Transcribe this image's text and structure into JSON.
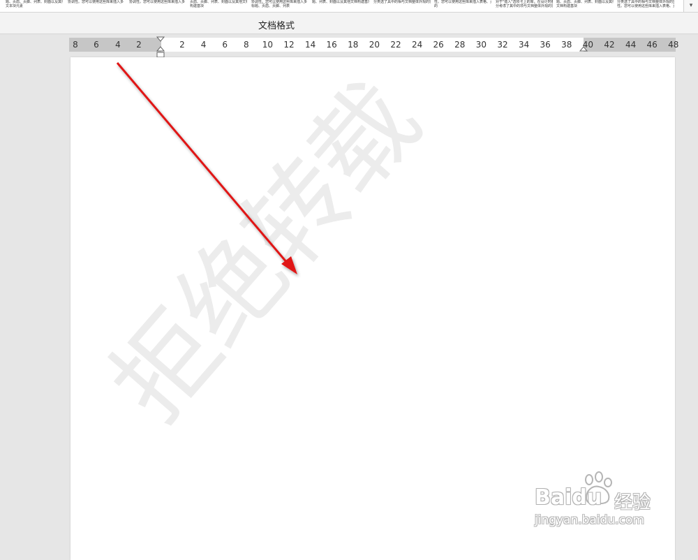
{
  "gallery": {
    "thumbnails": [
      [
        "题、页眉、页脚、列表、封面以及其他",
        "文本块元素"
      ],
      [
        "协调性。您可以使用这些库来插入多",
        ""
      ],
      [
        "协调性。您可以使用这些库来插入多",
        ""
      ],
      [
        "页眉、页脚、列表、封面以及其他文档",
        "构建基块"
      ],
      [
        "协调性。您可以使用这些库来插入多",
        "标题、页眉、页脚、列表"
      ],
      [
        "题、列表、封面以及其他文档构建基块。",
        ""
      ],
      [
        "",
        "分类选了具中的相与文档整体外观的协调"
      ],
      [
        "性。您可以使用这些库来插入表格、页",
        "的"
      ],
      [
        "对于\"插入\"选项卡上的库，在设计时都充",
        "分考虑了其中的项与文档整体外观的协调"
      ],
      [
        "题、页眉、页脚、列表、封面以及其他",
        "文档构建基块"
      ],
      [
        "分类选了具中的相与文档整体外观的协调",
        "性。您可以使用这些库来插入表格、页"
      ]
    ],
    "more_icon": "gallery-more-icon"
  },
  "ribbon": {
    "group_label": "文档格式"
  },
  "ruler": {
    "left_numbers": [
      "8",
      "6",
      "4",
      "2"
    ],
    "right_numbers": [
      "2",
      "4",
      "6",
      "8",
      "10",
      "12",
      "14",
      "16",
      "18",
      "20",
      "22",
      "24",
      "26",
      "28",
      "30",
      "32",
      "34",
      "36",
      "38",
      "40",
      "42",
      "44",
      "46",
      "48"
    ],
    "margin_color": "#c6c6c6"
  },
  "page": {
    "watermark_text": "拒绝转载",
    "watermark_color": "#ececec",
    "annotation_arrow_color": "#e01515"
  },
  "logo": {
    "brand": "Baidu",
    "product": "经验",
    "url": "jingyan.baidu.com"
  }
}
